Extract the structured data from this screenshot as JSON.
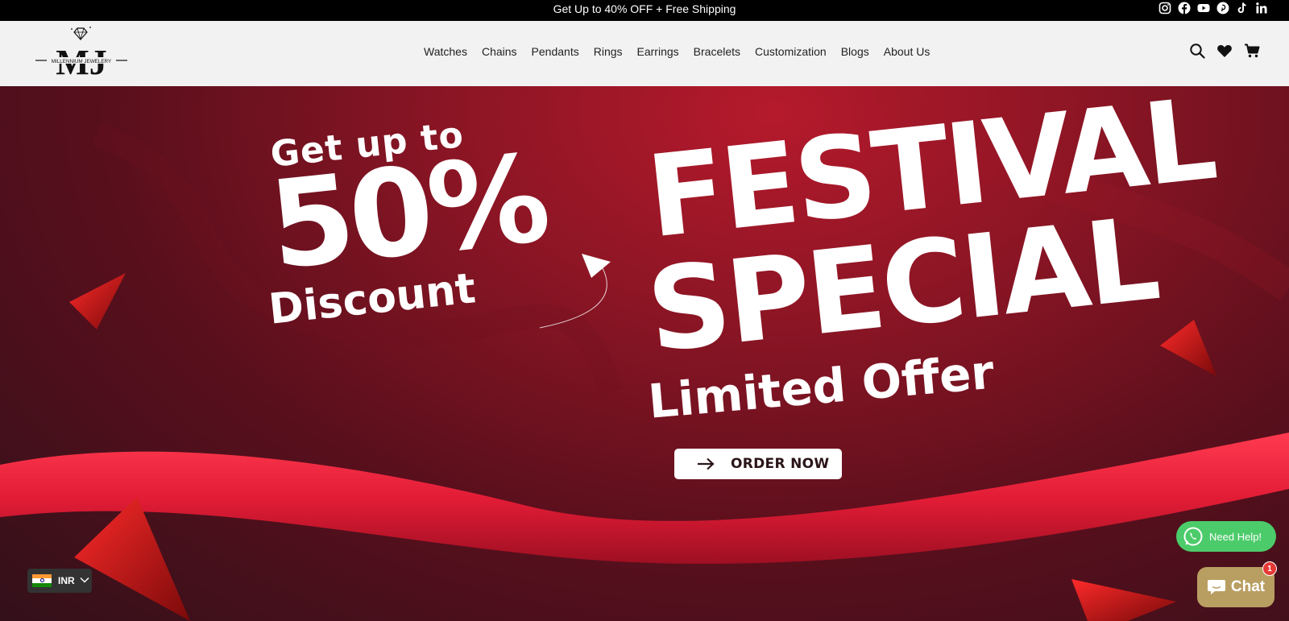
{
  "announcement": {
    "text": "Get Up to 40% OFF + Free Shipping",
    "social_icons": [
      "instagram-icon",
      "facebook-icon",
      "youtube-icon",
      "pinterest-icon",
      "tiktok-icon",
      "linkedin-icon"
    ]
  },
  "header": {
    "logo": {
      "monogram": "MJ",
      "brand": "MILLENNIUM JEWELERY"
    },
    "nav": [
      {
        "label": "Watches"
      },
      {
        "label": "Chains"
      },
      {
        "label": "Pendants"
      },
      {
        "label": "Rings"
      },
      {
        "label": "Earrings"
      },
      {
        "label": "Bracelets"
      },
      {
        "label": "Customization"
      },
      {
        "label": "Blogs"
      },
      {
        "label": "About Us"
      }
    ],
    "icons": [
      "search-icon",
      "wishlist-heart-icon",
      "cart-icon"
    ]
  },
  "hero": {
    "get_up_to": "Get up to",
    "percent": "50%",
    "discount": "Discount",
    "festival": "FESTIVAL",
    "special": "SPECIAL",
    "limited_offer": "Limited Offer",
    "cta_label": "ORDER NOW",
    "colors": {
      "background": "#8a1524",
      "ribbon": "#e8233a",
      "text": "#ffffff"
    }
  },
  "currency": {
    "code": "INR",
    "flag": "india-flag-icon"
  },
  "whatsapp": {
    "label": "Need Help!",
    "color": "#4ccb6a"
  },
  "chat": {
    "label": "Chat",
    "badge": "1",
    "color": "#b99e62"
  }
}
